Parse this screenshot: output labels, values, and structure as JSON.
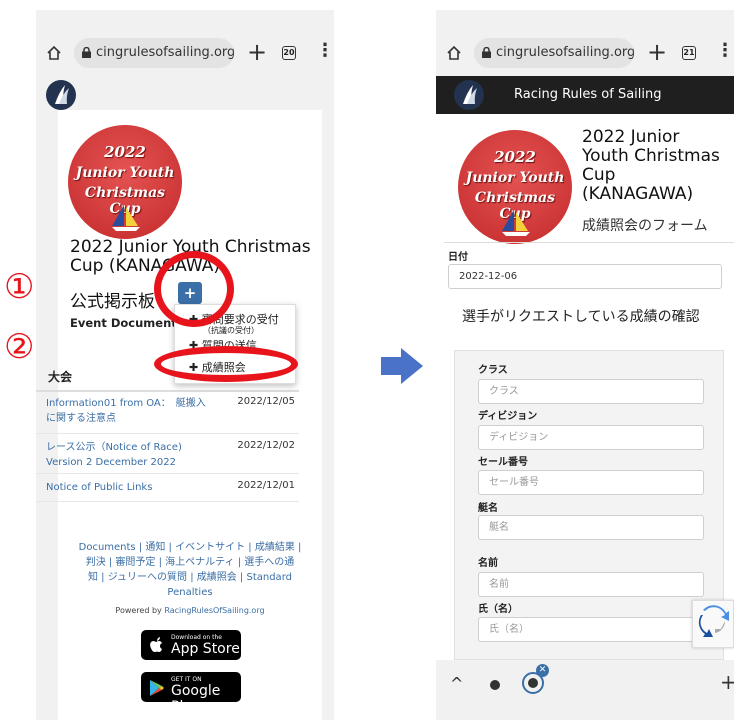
{
  "browser": {
    "url": "cingrulesofsailing.org",
    "tab_count_left": "20",
    "tab_count_right": "21",
    "plus": "+",
    "menu": "⋮"
  },
  "left": {
    "logo_text": [
      "2022",
      "Junior Youth",
      "Christmas Cup"
    ],
    "event_title_line1": "2022 Junior Youth Christmas",
    "event_title_line2": "Cup (KANAGAWA)",
    "board_title": "公式掲示板",
    "add_button": "+",
    "event_documents": "Event Documents",
    "dropdown": {
      "item1": "審問要求の受付",
      "item1_sub": "（抗議の受付）",
      "item2": "質問の送信",
      "item3": "成績照会"
    },
    "table_header": "大会",
    "rows": [
      {
        "title1": "Information01 from OA：　艇搬入",
        "title2": "に関する注意点",
        "date": "2022/12/05"
      },
      {
        "title1": "レース公示（Notice of Race)",
        "title2": "Version 2 December 2022",
        "date": "2022/12/02"
      },
      {
        "title1": "Notice of Public Links",
        "title2": "",
        "date": "2022/12/01"
      }
    ],
    "footer_line1": "Documents | 通知 | イベントサイト | 成績結果 |",
    "footer_line2": "判決 | 審問予定 | 海上ペナルティ | 選手への通",
    "footer_line3": "知 | ジュリーへの質問 | 成績照会 | Standard",
    "footer_line4": "Penalties",
    "powered_prefix": "Powered by ",
    "powered_link": "RacingRulesOfSailing.org",
    "app_store_small": "Download on the",
    "app_store": "App Store",
    "google_small": "GET IT ON",
    "google": "Google Play"
  },
  "annotations": {
    "num1": "①",
    "num2": "②",
    "accent": "#e8141c"
  },
  "right": {
    "header_title": "Racing Rules of Sailing",
    "title_line1": "2022 Junior",
    "title_line2": "Youth Christmas",
    "title_line3": "Cup",
    "title_line4": "(KANAGAWA)",
    "subtitle": "成績照会のフォーム",
    "date_label": "日付",
    "date_value": "2022-12-06",
    "section_title": "選手がリクエストしている成績の確認",
    "fields": [
      {
        "label": "クラス",
        "placeholder": "クラス"
      },
      {
        "label": "ディビジョン",
        "placeholder": "ディビジョン"
      },
      {
        "label": "セール番号",
        "placeholder": "セール番号"
      },
      {
        "label": "艇名",
        "placeholder": "艇名"
      },
      {
        "label": "名前",
        "placeholder": "名前"
      },
      {
        "label": "氏（名）",
        "placeholder": "氏（名）"
      }
    ],
    "bottom": {
      "caret": "^",
      "plus": "+"
    }
  }
}
